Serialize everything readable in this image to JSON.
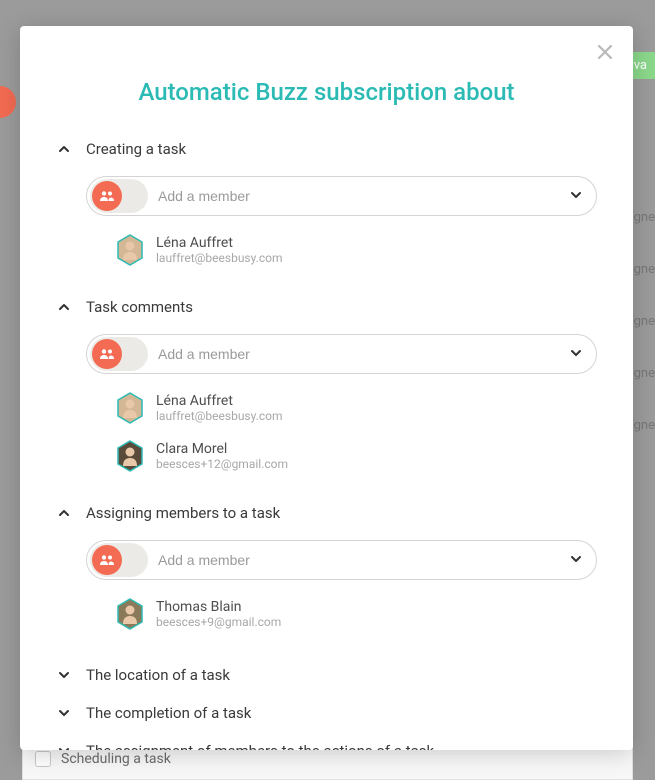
{
  "modal": {
    "title": "Automatic Buzz subscription about"
  },
  "background": {
    "pill_text": "e va",
    "assigne_text": "igne",
    "bottom_label": "Scheduling a task"
  },
  "input": {
    "placeholder": "Add a member"
  },
  "sections": [
    {
      "title": "Creating a task",
      "expanded": true,
      "members": [
        {
          "name": "Léna Auffret",
          "email": "lauffret@beesbusy.com",
          "avatar_fill": "#d4b896",
          "avatar_stroke": "#2cbab5"
        }
      ]
    },
    {
      "title": "Task comments",
      "expanded": true,
      "members": [
        {
          "name": "Léna Auffret",
          "email": "lauffret@beesbusy.com",
          "avatar_fill": "#d4b896",
          "avatar_stroke": "#2cbab5"
        },
        {
          "name": "Clara Morel",
          "email": "beesces+12@gmail.com",
          "avatar_fill": "#5a4a3a",
          "avatar_stroke": "#2cbab5"
        }
      ]
    },
    {
      "title": "Assigning members to a task",
      "expanded": true,
      "members": [
        {
          "name": "Thomas Blain",
          "email": "beesces+9@gmail.com",
          "avatar_fill": "#8a7a5a",
          "avatar_stroke": "#2cbab5"
        }
      ]
    },
    {
      "title": "The location of a task",
      "expanded": false,
      "members": []
    },
    {
      "title": "The completion of a task",
      "expanded": false,
      "members": []
    },
    {
      "title": "The assignment of members to the actions of a task",
      "expanded": false,
      "members": []
    }
  ]
}
